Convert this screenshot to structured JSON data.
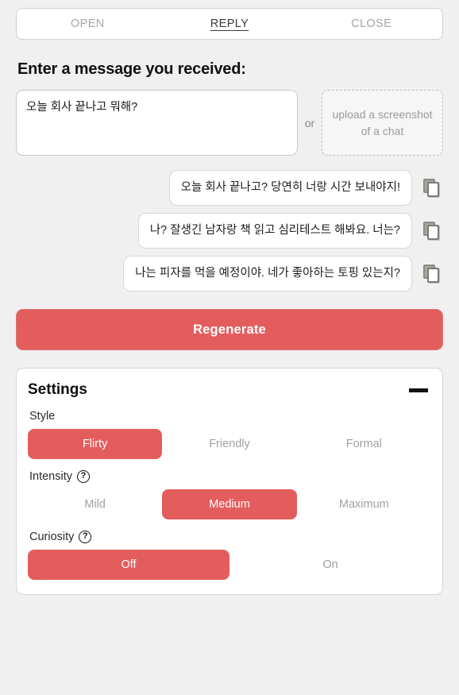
{
  "theme": {
    "accent": "#e45d5d",
    "background": "#f0f0f0",
    "card": "#ffffff",
    "muted_text": "#a0a0a0"
  },
  "tabs": [
    {
      "label": "OPEN",
      "active": false
    },
    {
      "label": "REPLY",
      "active": true
    },
    {
      "label": "CLOSE",
      "active": false
    }
  ],
  "heading": "Enter a message you received:",
  "input": {
    "value": "오늘 회사 끝나고 뭐해?",
    "placeholder": ""
  },
  "or_label": "or",
  "upload": {
    "label": "upload a screenshot of a chat"
  },
  "replies": [
    {
      "text": "오늘 회사 끝나고? 당연히 너랑 시간 보내야지!",
      "copy_icon": "copy-icon"
    },
    {
      "text": "나? 잘생긴 남자랑 책 읽고 심리테스트 해봐요. 너는?",
      "copy_icon": "copy-icon"
    },
    {
      "text": "나는 피자를 먹을 예정이야. 네가 좋아하는 토핑 있는지?",
      "copy_icon": "copy-icon"
    }
  ],
  "regenerate_label": "Regenerate",
  "settings": {
    "title": "Settings",
    "collapse_icon": "minus-icon",
    "fields": [
      {
        "label": "Style",
        "help": false,
        "help_icon": "",
        "options": [
          {
            "label": "Flirty",
            "selected": true
          },
          {
            "label": "Friendly",
            "selected": false
          },
          {
            "label": "Formal",
            "selected": false
          }
        ]
      },
      {
        "label": "Intensity",
        "help": true,
        "help_icon": "question-mark-icon",
        "help_glyph": "?",
        "options": [
          {
            "label": "Mild",
            "selected": false
          },
          {
            "label": "Medium",
            "selected": true
          },
          {
            "label": "Maximum",
            "selected": false
          }
        ]
      },
      {
        "label": "Curiosity",
        "help": true,
        "help_icon": "question-mark-icon",
        "help_glyph": "?",
        "options": [
          {
            "label": "Off",
            "selected": true
          },
          {
            "label": "On",
            "selected": false
          }
        ]
      }
    ]
  }
}
